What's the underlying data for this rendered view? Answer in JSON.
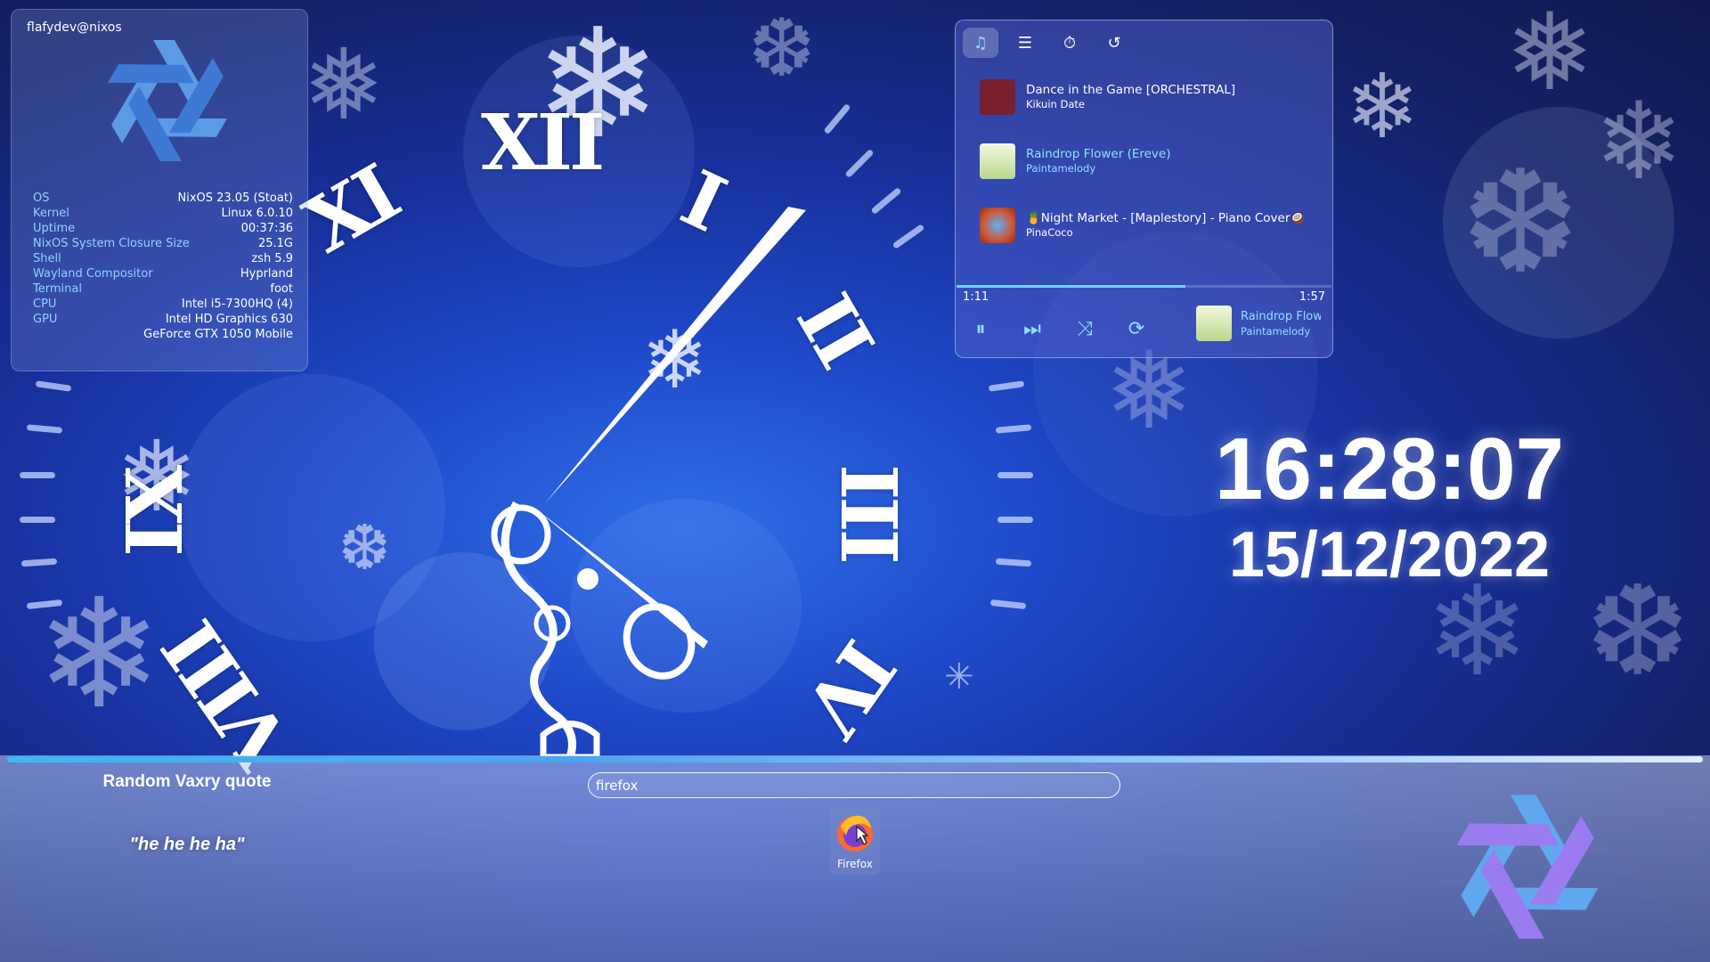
{
  "wallpaper": {
    "clock_numerals": [
      "XII",
      "I",
      "II",
      "III",
      "IV",
      "VIII",
      "IX",
      "XI"
    ]
  },
  "sysinfo": {
    "user_host": "flafydev@nixos",
    "rows": [
      {
        "key": "OS",
        "value": "NixOS 23.05 (Stoat)"
      },
      {
        "key": "Kernel",
        "value": "Linux 6.0.10"
      },
      {
        "key": "Uptime",
        "value": "00:37:36"
      },
      {
        "key": "NixOS System Closure Size",
        "value": "25.1G"
      },
      {
        "key": "Shell",
        "value": "zsh 5.9"
      },
      {
        "key": "Wayland Compositor",
        "value": "Hyprland"
      },
      {
        "key": "Terminal",
        "value": "foot"
      },
      {
        "key": "CPU",
        "value": "Intel  i5-7300HQ (4)"
      },
      {
        "key": "GPU",
        "value": "Intel  HD Graphics 630"
      },
      {
        "key": "",
        "value": "GeForce GTX 1050 Mobile"
      }
    ]
  },
  "player": {
    "tabs": [
      {
        "name": "music-note-icon",
        "glyph": "♫"
      },
      {
        "name": "list-icon",
        "glyph": "☰"
      },
      {
        "name": "timer-icon",
        "glyph": "⏱"
      },
      {
        "name": "history-icon",
        "glyph": "↺"
      }
    ],
    "tracks": [
      {
        "title": "Dance in the Game [ORCHESTRAL]",
        "artist": "Kikuin Date",
        "art_color": "#7a1f2e"
      },
      {
        "title": "Raindrop Flower (Ereve)",
        "artist": "Paintamelody",
        "art_color": "#e9f3c8"
      },
      {
        "title": "🍍Night Market - [Maplestory] - Piano Cover🥥",
        "artist": "PinaCoco",
        "art_color": "#c9472a"
      }
    ],
    "elapsed": "1:11",
    "duration": "1:57",
    "progress": 0.61,
    "controls": {
      "pause": "⏸",
      "next": "⏭",
      "shuffle": "⤨",
      "repeat": "⟳"
    },
    "now_playing": {
      "title": "Raindrop Flower (Ereve)",
      "artist": "Paintamelody"
    }
  },
  "clock": {
    "time": "16:28:07",
    "date": "15/12/2022"
  },
  "launcher": {
    "quote_title": "Random Vaxry quote",
    "quote_text": "\"he he he ha\"",
    "search_value": "firefox",
    "apps": [
      {
        "label": "Firefox",
        "icon": "firefox-icon"
      }
    ]
  },
  "colors": {
    "accent": "#8fe0ff",
    "nix_blue": "#5fa8ee",
    "nix_purple": "#9b7cf0"
  }
}
